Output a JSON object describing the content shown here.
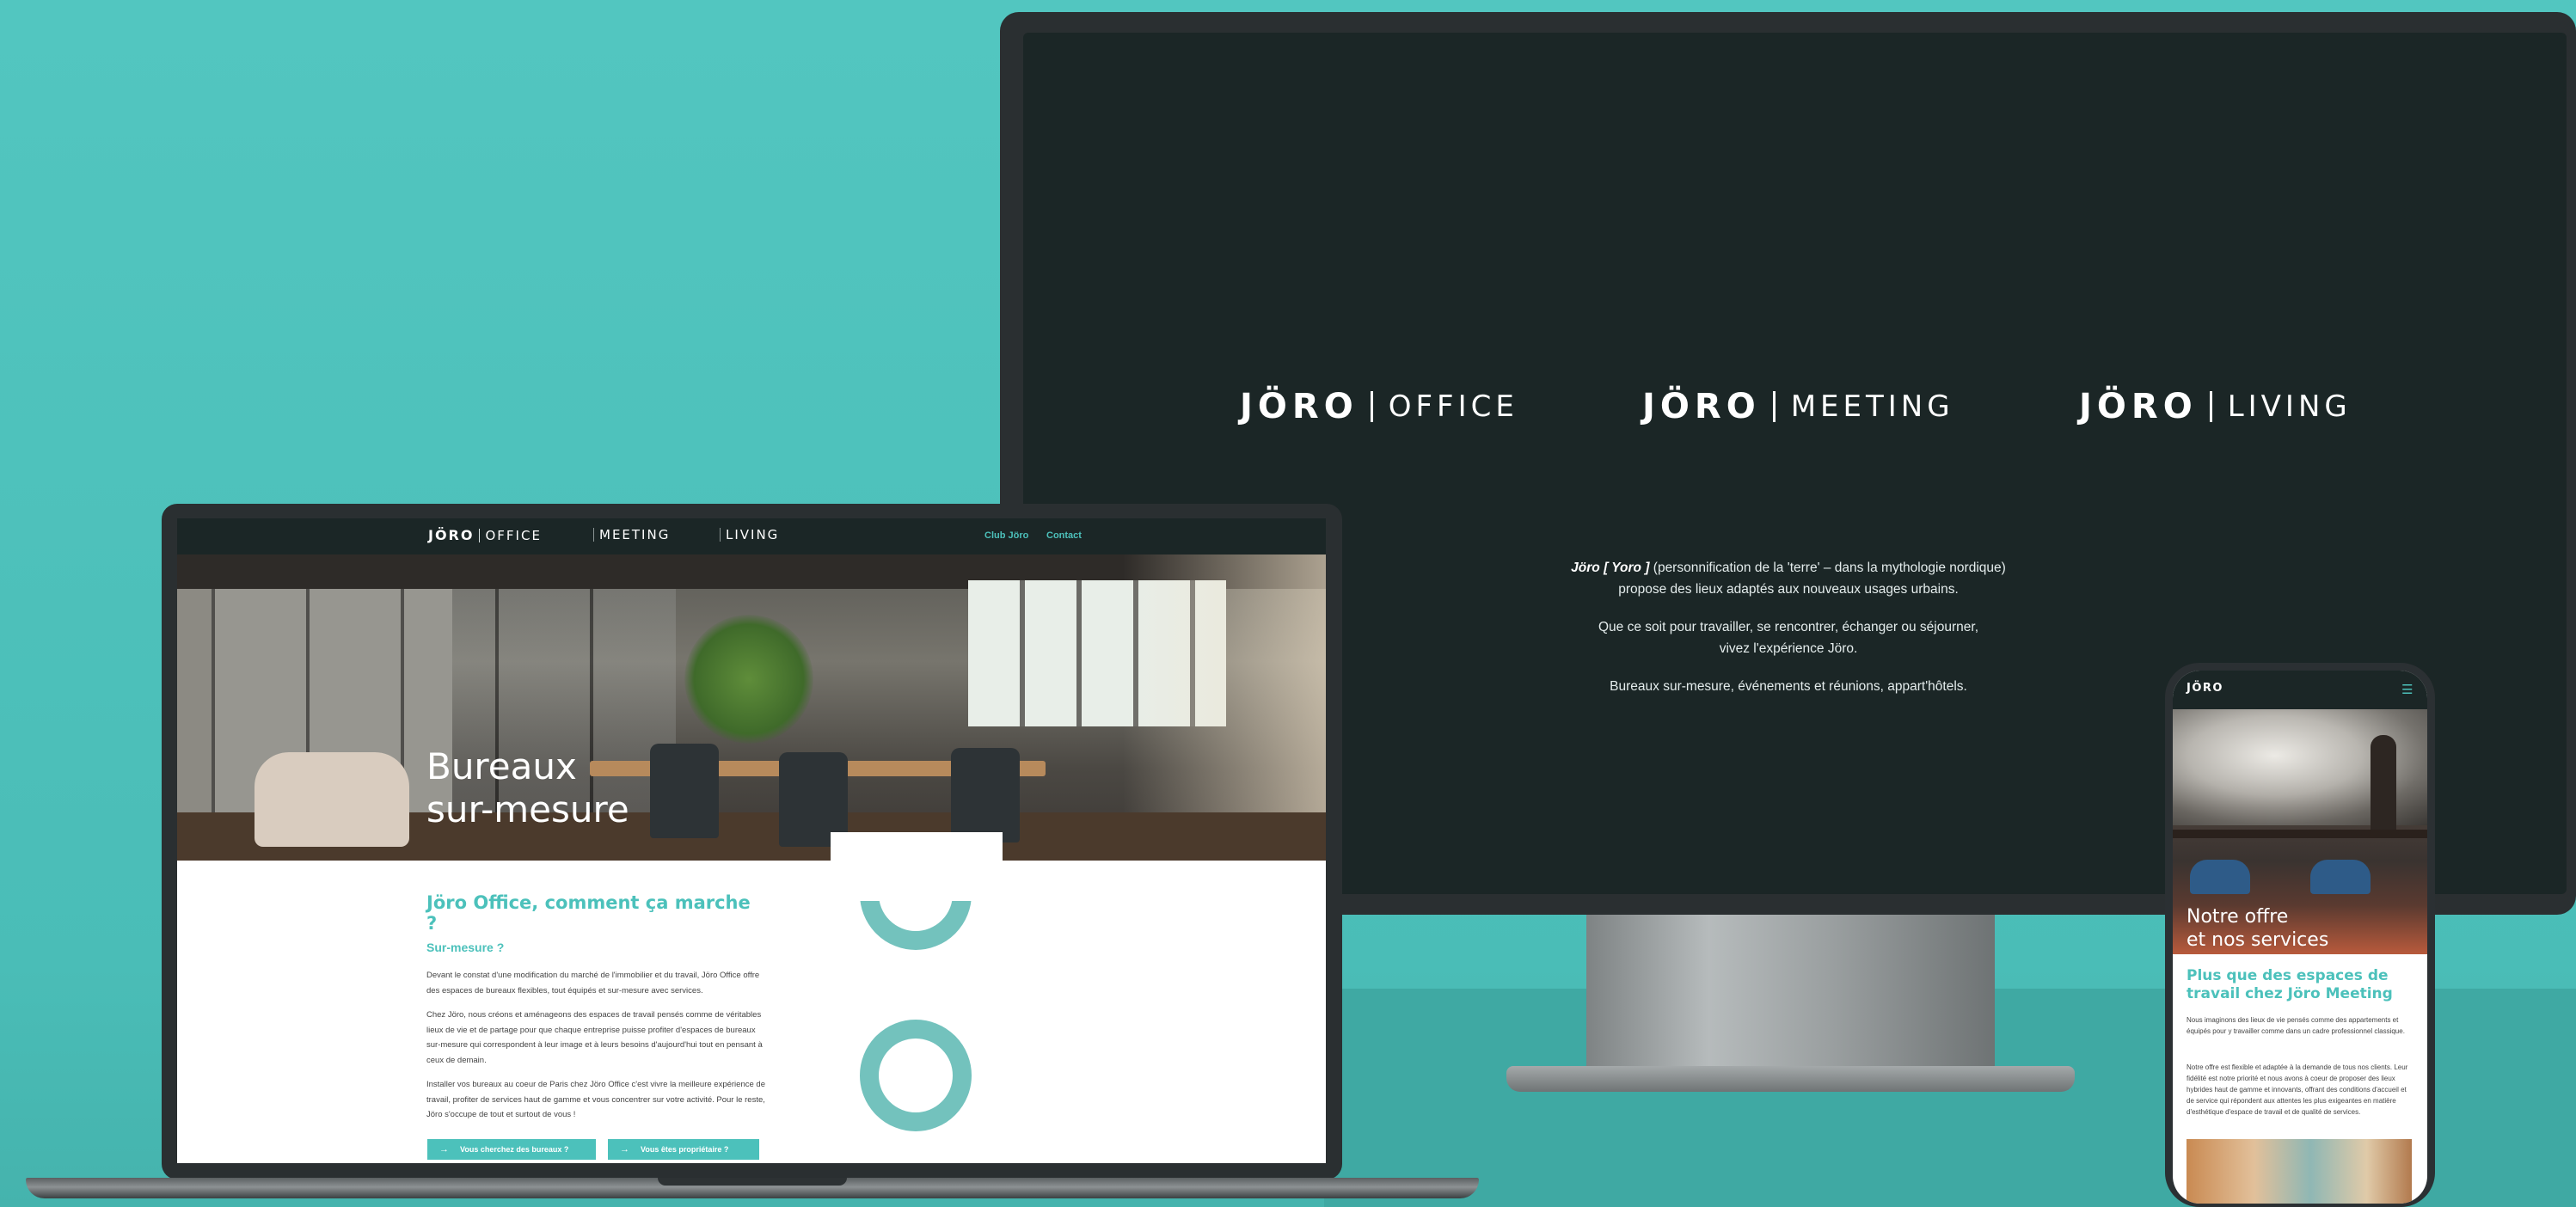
{
  "monitor": {
    "brands": [
      {
        "word": "JÖRO",
        "sub": "OFFICE"
      },
      {
        "word": "JÖRO",
        "sub": "MEETING"
      },
      {
        "word": "JÖRO",
        "sub": "LIVING"
      }
    ],
    "intro": {
      "l1_name": "Jöro [ Yoro ]",
      "l1_rest": "(personnification de la 'terre' – dans la mythologie nordique)",
      "l2": "propose des lieux adaptés aux nouveaux usages urbains.",
      "l3": "Que ce soit pour travailler, se rencontrer, échanger ou séjourner,",
      "l4": "vivez l'expérience Jöro.",
      "l5": "Bureaux sur-mesure, événements et réunions, appart'hôtels."
    }
  },
  "laptop": {
    "nav": {
      "logo_word": "JÖRO",
      "logo_sub": "OFFICE",
      "meeting": "MEETING",
      "living": "LIVING",
      "club": "Club Jöro",
      "contact": "Contact"
    },
    "hero_title_l1": "Bureaux",
    "hero_title_l2": "sur-mesure",
    "heading": "Jöro Office, comment ça marche ?",
    "subheading": "Sur-mesure ?",
    "paragraphs": [
      "Devant le constat d'une modification du marché de l'immobilier et du travail, Jöro Office offre des espaces de bureaux flexibles, tout équipés et sur-mesure avec services.",
      "Chez Jöro, nous créons et aménageons des espaces de travail pensés comme de véritables lieux de vie et de partage pour que chaque entreprise puisse profiter d'espaces de bureaux sur-mesure qui correspondent à leur image et à leurs besoins d'aujourd'hui tout en pensant à ceux de demain.",
      "Installer vos bureaux au coeur de Paris chez Jöro Office c'est vivre la meilleure expérience de travail, profiter de services haut de gamme et vous concentrer sur votre activité. Pour le reste, Jöro s'occupe de tout et surtout de vous !"
    ],
    "btn_search": "Vous cherchez des bureaux ?",
    "btn_owner": "Vous êtes propriétaire ?"
  },
  "phone": {
    "logo": "JÖRO",
    "menu_icon": "☰",
    "hero_title_l1": "Notre offre",
    "hero_title_l2": "et nos services",
    "heading": "Plus que des espaces de travail chez Jöro Meeting",
    "p1": "Nous imaginons des lieux de vie pensés comme des appartements et équipés pour y travailler comme dans un cadre professionnel classique.",
    "p2": "Notre offre est flexible et adaptée à la demande de tous nos clients. Leur fidélité est notre priorité et nous avons à coeur de proposer des lieux hybrides haut de gamme et innovants, offrant des conditions d'accueil et de service qui répondent aux attentes les plus exigeantes en matière d'esthétique d'espace de travail et de qualité de services."
  },
  "colors": {
    "background": "#4cc1bb",
    "accent": "#4cc1bb",
    "screen_dark": "#1b2626"
  }
}
